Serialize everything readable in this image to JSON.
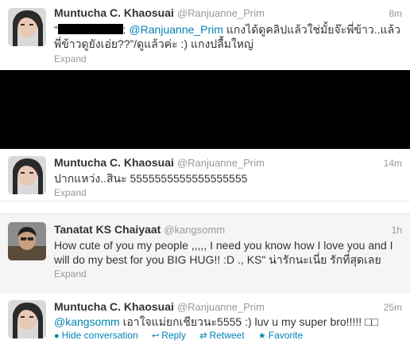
{
  "tweets": [
    {
      "name": "Muntucha C. Khaosuai",
      "handle": "@Ranjuanne_Prim",
      "time": "8m",
      "quote_open": "“",
      "mention": "@Ranjuanne_Prim",
      "text_after_mention": " แกงได้ดูคลิปแล้วใช่มั้ยจ๊ะพี่ข้าว..แล้ว",
      "text_line2": "พี่ข้าวดูยังเอ่ย??”/ดูแล้วค่ะ :) แกงปลื้มใหญ่",
      "expand": "Expand"
    },
    {
      "name": "Muntucha C. Khaosuai",
      "handle": "@Ranjuanne_Prim",
      "time": "14m",
      "text": "ปากแหว่ง..สินะ 5555555555555555555",
      "expand": "Expand"
    },
    {
      "name": "Tanatat KS Chaiyaat",
      "handle": "@kangsomm",
      "time": "1h",
      "text_line1": "How cute of you my people ,,,,, I need you know how I love you and I",
      "text_line2": "will do my best for you BIG HUG!! :D ., KS\" น่ารักนะเนี่ย รักที่สุดเลย",
      "expand": "Expand"
    },
    {
      "name": "Muntucha C. Khaosuai",
      "handle": "@Ranjuanne_Prim",
      "time": "25m",
      "mention": "@kangsomm",
      "text_after_mention": " เอาใจแม่ยกเชียวนะ5555 :) luv u my super bro!!!!! □□"
    }
  ],
  "actions": {
    "hide_conversation": "Hide conversation",
    "reply": "Reply",
    "retweet": "Retweet",
    "favorite": "Favorite"
  },
  "colors": {
    "link": "#0084b4",
    "muted": "#999999",
    "text": "#333333",
    "hover_bg": "#f5f5f5"
  }
}
